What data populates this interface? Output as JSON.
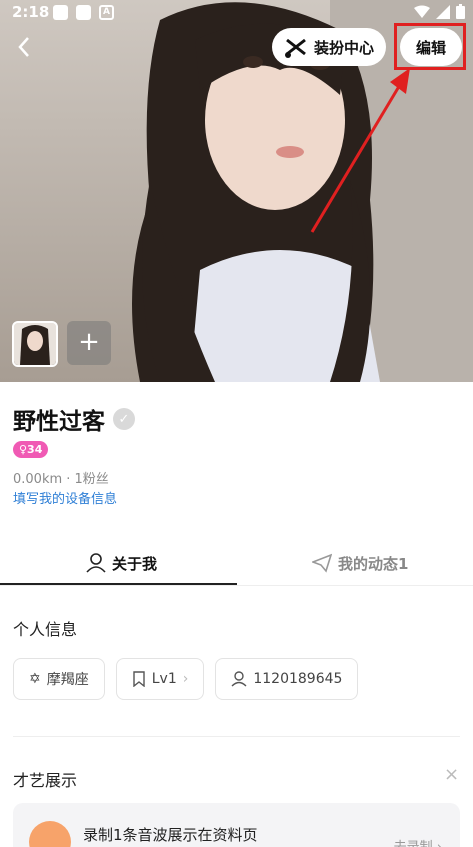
{
  "status_bar": {
    "time": "2:18",
    "notif_icon": "A"
  },
  "header": {
    "back_icon": "chevron-left-icon",
    "dress_center_label": "装扮中心",
    "edit_label": "编辑"
  },
  "profile": {
    "name": "野性过客",
    "level": "♀34",
    "meta": "0.00km · 1粉丝",
    "device_link": "填写我的设备信息"
  },
  "tabs": [
    {
      "label": "关于我",
      "icon": "person-icon",
      "active": true
    },
    {
      "label": "我的动态1",
      "icon": "send-icon",
      "active": false
    }
  ],
  "personal_info": {
    "title": "个人信息",
    "chips": [
      {
        "label": "摩羯座",
        "icon": "star-icon"
      },
      {
        "label": "Lv1",
        "icon": "bookmark-icon",
        "arrow": "›"
      },
      {
        "label": "1120189645",
        "icon": "person-icon"
      }
    ]
  },
  "talent": {
    "title": "才艺展示",
    "close": "×",
    "card_text": "录制1条音波展示在资料页",
    "card_action": "去录制 ›"
  },
  "colors": {
    "accent_pink": "#f05ab4",
    "link_blue": "#2f7fd6",
    "highlight_red": "#e02020"
  }
}
